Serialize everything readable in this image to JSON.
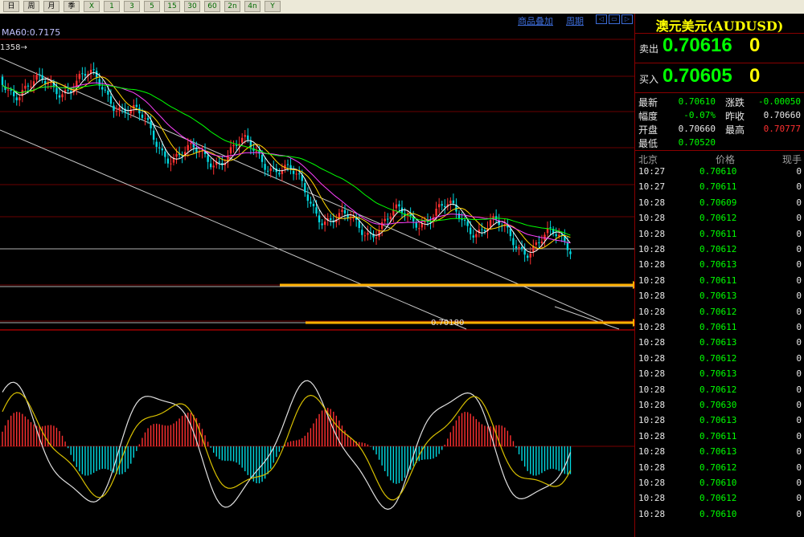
{
  "toolbar": {
    "buttons": [
      "日",
      "周",
      "月",
      "季",
      "X",
      "1",
      "3",
      "5",
      "15",
      "30",
      "60",
      "2n",
      "4n",
      "Y"
    ]
  },
  "chart": {
    "ma_label": "MA60:0.7175",
    "high_marker": "1358→",
    "low_marker": "0.70180",
    "links": [
      "商品叠加",
      "周期"
    ],
    "scroll_buttons": [
      "◁",
      "▭",
      "▷"
    ],
    "colors": {
      "up": "#ff3030",
      "down": "#00d8e0",
      "ma5": "#ffffff",
      "ma10": "#ffd700",
      "ma20": "#ff40ff",
      "ma60": "#00ff00",
      "arrow": "#ffb000"
    }
  },
  "panel": {
    "title": "澳元美元(AUDUSD)",
    "sell_label": "卖出",
    "sell_value": "0.70616",
    "sell_extra": "0",
    "buy_label": "买入",
    "buy_value": "0.70605",
    "buy_extra": "0",
    "stats": {
      "latest_label": "最新",
      "latest_value": "0.70610",
      "change_label": "涨跌",
      "change_value": "-0.00050",
      "range_label": "幅度",
      "range_value": "-0.07%",
      "prev_close_label": "昨收",
      "prev_close_value": "0.70660",
      "open_label": "开盘",
      "open_value": "0.70660",
      "high_label": "最高",
      "high_value": "0.70777",
      "low_label": "最低",
      "low_value": "0.70520"
    },
    "ticks_header": {
      "time": "北京",
      "price": "价格",
      "volume": "现手"
    },
    "ticks": [
      {
        "time": "10:27",
        "price": "0.70610",
        "volume": "0"
      },
      {
        "time": "10:27",
        "price": "0.70611",
        "volume": "0"
      },
      {
        "time": "10:28",
        "price": "0.70609",
        "volume": "0"
      },
      {
        "time": "10:28",
        "price": "0.70612",
        "volume": "0"
      },
      {
        "time": "10:28",
        "price": "0.70611",
        "volume": "0"
      },
      {
        "time": "10:28",
        "price": "0.70612",
        "volume": "0"
      },
      {
        "time": "10:28",
        "price": "0.70613",
        "volume": "0"
      },
      {
        "time": "10:28",
        "price": "0.70611",
        "volume": "0"
      },
      {
        "time": "10:28",
        "price": "0.70613",
        "volume": "0"
      },
      {
        "time": "10:28",
        "price": "0.70612",
        "volume": "0"
      },
      {
        "time": "10:28",
        "price": "0.70611",
        "volume": "0"
      },
      {
        "time": "10:28",
        "price": "0.70613",
        "volume": "0"
      },
      {
        "time": "10:28",
        "price": "0.70612",
        "volume": "0"
      },
      {
        "time": "10:28",
        "price": "0.70613",
        "volume": "0"
      },
      {
        "time": "10:28",
        "price": "0.70612",
        "volume": "0"
      },
      {
        "time": "10:28",
        "price": "0.70630",
        "volume": "0"
      },
      {
        "time": "10:28",
        "price": "0.70613",
        "volume": "0"
      },
      {
        "time": "10:28",
        "price": "0.70611",
        "volume": "0"
      },
      {
        "time": "10:28",
        "price": "0.70613",
        "volume": "0"
      },
      {
        "time": "10:28",
        "price": "0.70612",
        "volume": "0"
      },
      {
        "time": "10:28",
        "price": "0.70610",
        "volume": "0"
      },
      {
        "time": "10:28",
        "price": "0.70612",
        "volume": "0"
      },
      {
        "time": "10:28",
        "price": "0.70610",
        "volume": "0"
      }
    ]
  }
}
